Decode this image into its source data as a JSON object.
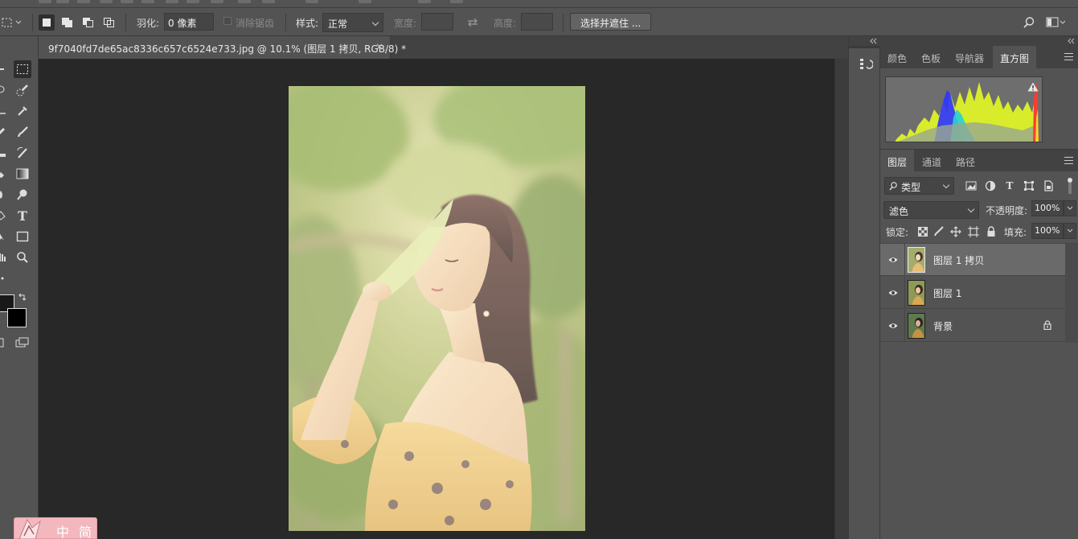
{
  "options_bar": {
    "feather_label": "羽化:",
    "feather_value": "0 像素",
    "antialias_label": "消除锯齿",
    "style_label": "样式:",
    "style_value": "正常",
    "width_label": "宽度:",
    "height_label": "高度:",
    "select_mask_button": "选择并遮住 ..."
  },
  "document": {
    "tab_title": "9f7040fd7de65ac8336c657c6524e733.jpg @ 10.1% (图层 1 拷贝, RGB/8) *",
    "close_glyph": "×"
  },
  "top_panel": {
    "tabs": [
      "颜色",
      "色板",
      "导航器",
      "直方图"
    ],
    "active_tab": "直方图"
  },
  "layers_panel": {
    "tabs": [
      "图层",
      "通道",
      "路径"
    ],
    "active_tab": "图层",
    "filter_label": "类型",
    "blend_mode": "滤色",
    "opacity_label": "不透明度:",
    "opacity_value": "100%",
    "lock_label": "锁定:",
    "fill_label": "填充:",
    "fill_value": "100%",
    "layers": [
      {
        "name": "图层 1 拷贝",
        "selected": true,
        "locked": false
      },
      {
        "name": "图层 1",
        "selected": false,
        "locked": false
      },
      {
        "name": "背景",
        "selected": false,
        "locked": true
      }
    ]
  },
  "toolbar": {
    "type_tool_glyph": "T"
  },
  "ime_bar": {
    "mode_1": "中",
    "mode_2": "简"
  },
  "colors": {
    "ui_bg": "#535353",
    "canvas_bg": "#282828",
    "panel_tab_bg": "#424242",
    "selected_layer": "#6a6a6a"
  }
}
